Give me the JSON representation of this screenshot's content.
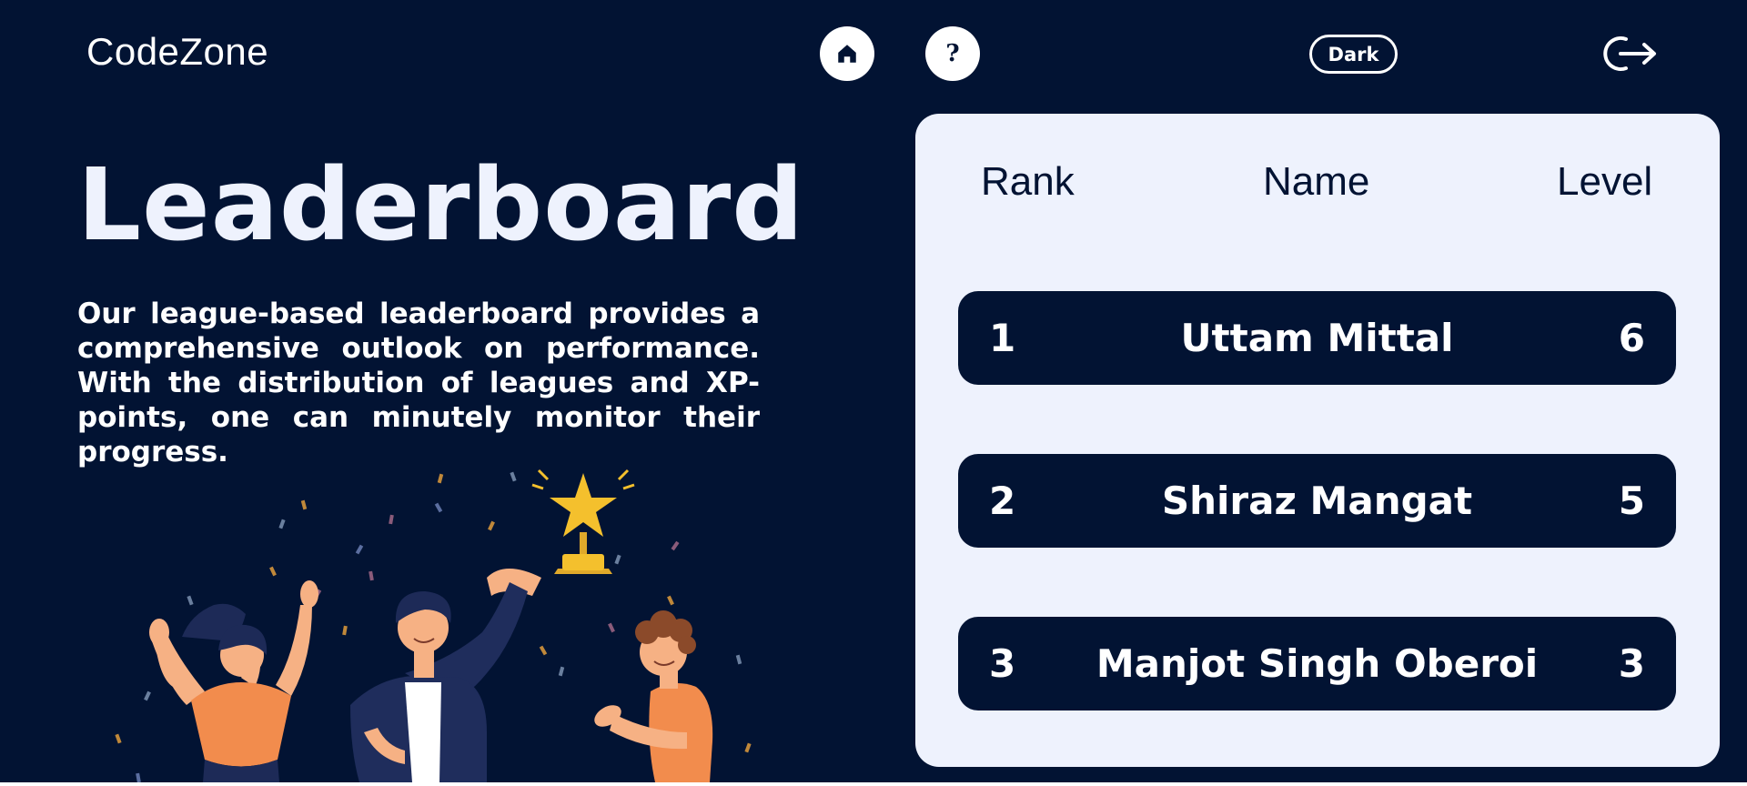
{
  "app": {
    "brand": "CodeZone"
  },
  "nav": {
    "home_icon": "home-icon",
    "help_icon": "question-icon",
    "help_glyph": "?",
    "theme_label": "Dark",
    "logout_icon": "logout-icon"
  },
  "hero": {
    "title": "Leaderboard",
    "description": "Our league-based leaderboard provides a comprehensive outlook on performance. With the distribution of leagues and XP-points, one can minutely monitor their progress."
  },
  "leaderboard": {
    "columns": [
      "Rank",
      "Name",
      "Level"
    ],
    "rows": [
      {
        "rank": "1",
        "name": "Uttam Mittal",
        "level": "6"
      },
      {
        "rank": "2",
        "name": "Shiraz Mangat",
        "level": "5"
      },
      {
        "rank": "3",
        "name": "Manjot Singh Oberoi",
        "level": "3"
      }
    ]
  },
  "colors": {
    "background": "#021333",
    "card": "#eef2fd",
    "accent_orange": "#f28c4d",
    "trophy_gold": "#f4c02d"
  }
}
